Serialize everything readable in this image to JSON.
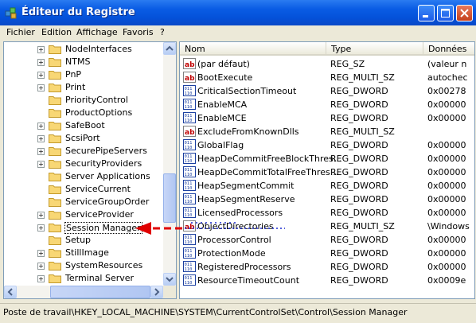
{
  "window": {
    "title": "Éditeur du Registre"
  },
  "menu": [
    "Fichier",
    "Edition",
    "Affichage",
    "Favoris",
    "?"
  ],
  "tree": {
    "items": [
      {
        "label": "NodeInterfaces",
        "expandable": true
      },
      {
        "label": "NTMS",
        "expandable": true
      },
      {
        "label": "PnP",
        "expandable": true
      },
      {
        "label": "Print",
        "expandable": true
      },
      {
        "label": "PriorityControl",
        "expandable": false
      },
      {
        "label": "ProductOptions",
        "expandable": false
      },
      {
        "label": "SafeBoot",
        "expandable": true
      },
      {
        "label": "ScsiPort",
        "expandable": true
      },
      {
        "label": "SecurePipeServers",
        "expandable": true
      },
      {
        "label": "SecurityProviders",
        "expandable": true
      },
      {
        "label": "Server Applications",
        "expandable": false
      },
      {
        "label": "ServiceCurrent",
        "expandable": false
      },
      {
        "label": "ServiceGroupOrder",
        "expandable": false
      },
      {
        "label": "ServiceProvider",
        "expandable": true
      },
      {
        "label": "Session Manager",
        "expandable": true,
        "selected": true
      },
      {
        "label": "Setup",
        "expandable": false
      },
      {
        "label": "StillImage",
        "expandable": true
      },
      {
        "label": "SystemResources",
        "expandable": true
      },
      {
        "label": "Terminal Server",
        "expandable": true
      }
    ]
  },
  "list": {
    "columns": [
      "Nom",
      "Type",
      "Données"
    ],
    "rows": [
      {
        "icon": "string-value-icon",
        "name": "(par défaut)",
        "type": "REG_SZ",
        "data": "(valeur n"
      },
      {
        "icon": "string-value-icon",
        "name": "BootExecute",
        "type": "REG_MULTI_SZ",
        "data": "autochec"
      },
      {
        "icon": "binary-value-icon",
        "name": "CriticalSectionTimeout",
        "type": "REG_DWORD",
        "data": "0x00278"
      },
      {
        "icon": "binary-value-icon",
        "name": "EnableMCA",
        "type": "REG_DWORD",
        "data": "0x00000"
      },
      {
        "icon": "binary-value-icon",
        "name": "EnableMCE",
        "type": "REG_DWORD",
        "data": "0x00000"
      },
      {
        "icon": "string-value-icon",
        "name": "ExcludeFromKnownDlls",
        "type": "REG_MULTI_SZ",
        "data": ""
      },
      {
        "icon": "binary-value-icon",
        "name": "GlobalFlag",
        "type": "REG_DWORD",
        "data": "0x00000"
      },
      {
        "icon": "binary-value-icon",
        "name": "HeapDeCommitFreeBlockThres...",
        "type": "REG_DWORD",
        "data": "0x00000"
      },
      {
        "icon": "binary-value-icon",
        "name": "HeapDeCommitTotalFreeThres...",
        "type": "REG_DWORD",
        "data": "0x00000"
      },
      {
        "icon": "binary-value-icon",
        "name": "HeapSegmentCommit",
        "type": "REG_DWORD",
        "data": "0x00000"
      },
      {
        "icon": "binary-value-icon",
        "name": "HeapSegmentReserve",
        "type": "REG_DWORD",
        "data": "0x00000"
      },
      {
        "icon": "binary-value-icon",
        "name": "LicensedProcessors",
        "type": "REG_DWORD",
        "data": "0x00000"
      },
      {
        "icon": "string-value-icon",
        "name": "ObjectDirectories",
        "type": "REG_MULTI_SZ",
        "data": "\\Windows"
      },
      {
        "icon": "binary-value-icon",
        "name": "ProcessorControl",
        "type": "REG_DWORD",
        "data": "0x00000"
      },
      {
        "icon": "binary-value-icon",
        "name": "ProtectionMode",
        "type": "REG_DWORD",
        "data": "0x00000"
      },
      {
        "icon": "binary-value-icon",
        "name": "RegisteredProcessors",
        "type": "REG_DWORD",
        "data": "0x00000"
      },
      {
        "icon": "binary-value-icon",
        "name": "ResourceTimeoutCount",
        "type": "REG_DWORD",
        "data": "0x0009e"
      }
    ]
  },
  "statusbar": {
    "path": "Poste de travail\\HKEY_LOCAL_MACHINE\\SYSTEM\\CurrentControlSet\\Control\\Session Manager"
  },
  "annotation": {
    "color": "#e00000",
    "icon": "red-dashed-arrow-icon"
  }
}
